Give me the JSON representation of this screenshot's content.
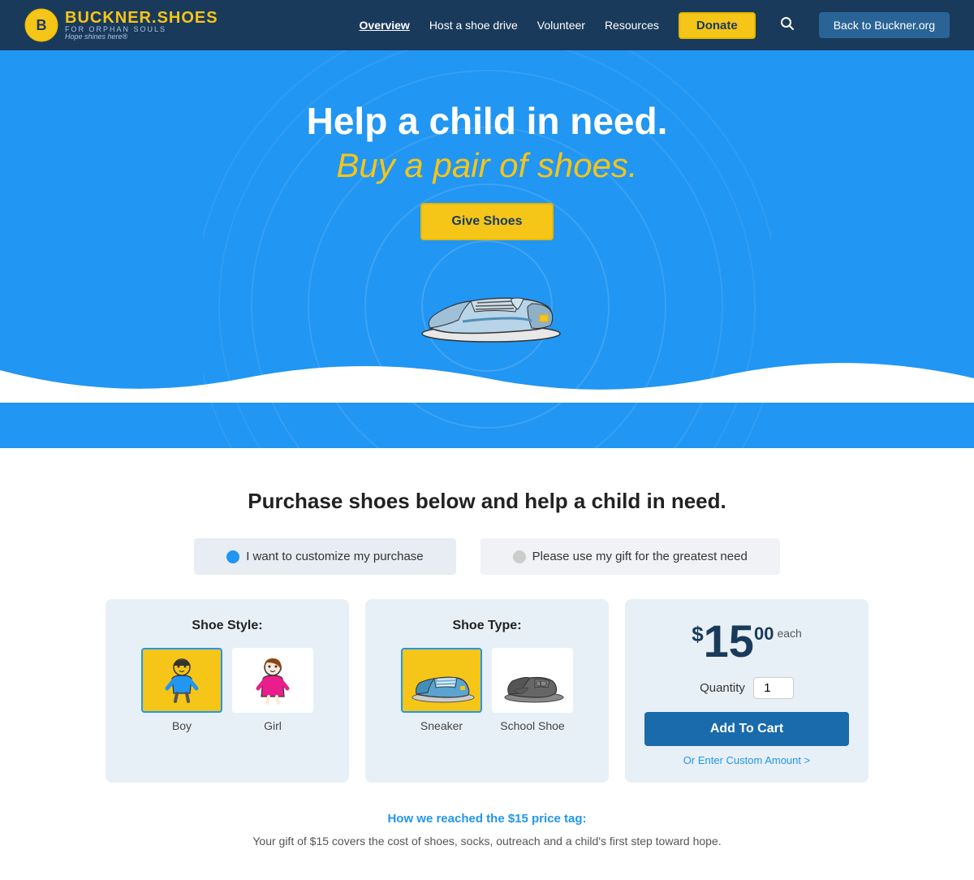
{
  "header": {
    "logo_brand": "BUCKNER.",
    "logo_brand_suffix": "SHOES",
    "logo_subtitle": "FOR ORPHAN SOULS",
    "logo_tagline": "Hope shines here®",
    "nav": [
      {
        "label": "Overview",
        "active": true
      },
      {
        "label": "Host a shoe drive",
        "active": false
      },
      {
        "label": "Volunteer",
        "active": false
      },
      {
        "label": "Resources",
        "active": false
      }
    ],
    "donate_label": "Donate",
    "back_label": "Back to Buckner.org"
  },
  "hero": {
    "title": "Help a child in need.",
    "subtitle": "Buy a pair of shoes.",
    "cta_label": "Give Shoes"
  },
  "main": {
    "section_title": "Purchase shoes below and help a child in need.",
    "radio_options": [
      {
        "label": "I want to customize my purchase",
        "selected": true
      },
      {
        "label": "Please use my gift for the greatest need",
        "selected": false
      }
    ],
    "shoe_style": {
      "title": "Shoe Style:",
      "options": [
        {
          "label": "Boy",
          "selected": true
        },
        {
          "label": "Girl",
          "selected": false
        }
      ]
    },
    "shoe_type": {
      "title": "Shoe Type:",
      "options": [
        {
          "label": "Sneaker",
          "selected": true
        },
        {
          "label": "School Shoe",
          "selected": false
        }
      ]
    },
    "price": {
      "dollar": "$",
      "main": "15",
      "cents": "00",
      "each": "each",
      "quantity_label": "Quantity",
      "quantity_value": "1",
      "add_cart_label": "Add To Cart",
      "custom_amount_label": "Or Enter Custom Amount >"
    },
    "price_info": {
      "link_label": "How we reached the $15 price tag:",
      "description": "Your gift of $15 covers the cost of shoes, socks, outreach and a child's first step toward hope."
    }
  }
}
